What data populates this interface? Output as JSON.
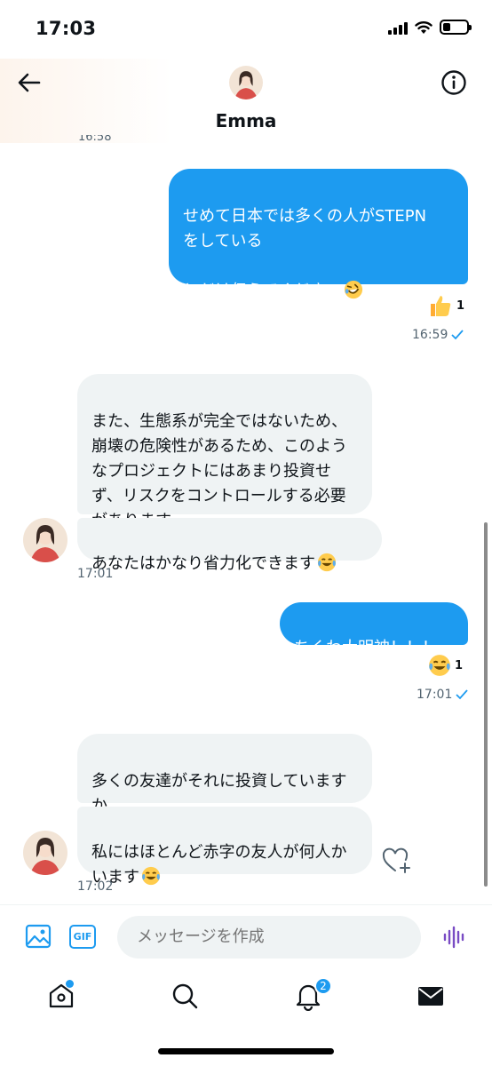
{
  "status": {
    "time": "17:03"
  },
  "header": {
    "name": "Emma",
    "partial_time": "16:58"
  },
  "messages": {
    "m1": {
      "text": "せめて日本では多くの人がSTEPN\nをしている\n\nとだけ伝えてください",
      "emoji": "rofl-emoji",
      "reaction_count": "1",
      "reaction": "thumbs-up-emoji",
      "time": "16:59"
    },
    "m2": {
      "text": "また、生態系が完全ではないため、崩壊の危険性があるため、このようなプロジェクトにはあまり投資せず、リスクをコントロールする必要があります"
    },
    "m3": {
      "text": "あなたはかなり省力化できます",
      "emoji": "joy-emoji",
      "time": "17:01"
    },
    "m4": {
      "text": "ちくわ大明神！！！",
      "reaction": "joy-emoji",
      "reaction_count": "1",
      "time": "17:01"
    },
    "m5": {
      "text": "多くの友達がそれに投資していますか"
    },
    "m6": {
      "text": "私にはほとんど赤字の友人が何人かいます",
      "emoji": "joy-emoji",
      "time": "17:02"
    }
  },
  "composer": {
    "placeholder": "メッセージを作成",
    "gif_label": "GIF"
  },
  "tabbar": {
    "notifications_badge": "2"
  },
  "colors": {
    "accent": "#1d9bf0",
    "received_bubble": "#eff3f4",
    "voice": "#794bc4"
  }
}
